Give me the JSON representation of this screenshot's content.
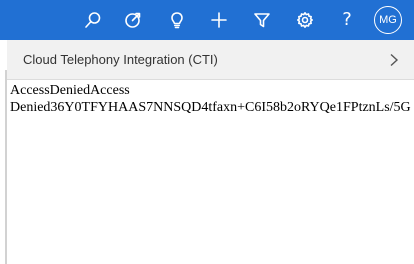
{
  "topbar": {
    "color": "#2170d3",
    "icons": [
      "search-icon",
      "target-icon",
      "lightbulb-icon",
      "plus-icon",
      "filter-icon",
      "gear-icon",
      "help-icon"
    ],
    "help_glyph": "?",
    "avatar_initials": "MG"
  },
  "panel": {
    "title": "Cloud Telephony Integration (CTI)",
    "expand_icon": "chevron-right-icon"
  },
  "content": {
    "line1": "AccessDeniedAccess",
    "line2": "Denied36Y0TFYHAAS7NNSQD4tfaxn+C6I58b2oRYQe1FPtznLs/5G"
  }
}
